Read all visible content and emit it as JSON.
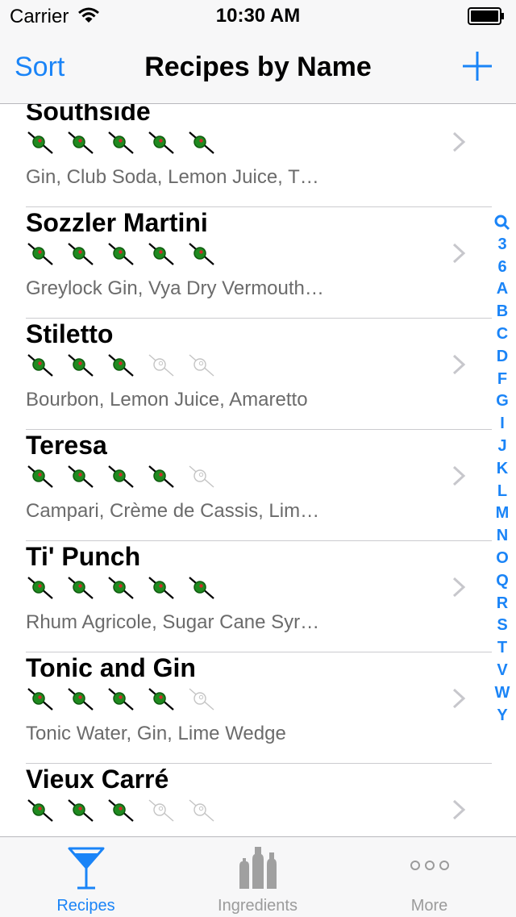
{
  "status": {
    "carrier": "Carrier",
    "time": "10:30 AM"
  },
  "nav": {
    "sort_label": "Sort",
    "title": "Recipes by Name",
    "add_icon": "plus-icon"
  },
  "colors": {
    "accent": "#1a84f7",
    "olive_active": "#1f8a1f",
    "olive_inactive": "#c4c4c4",
    "secondary_text": "#6b6b6b",
    "tab_inactive": "#9b9b9b"
  },
  "recipes": [
    {
      "name": "Southside",
      "rating": 5,
      "ingredients": "Gin, Club Soda, Lemon Juice, T…"
    },
    {
      "name": "Sozzler Martini",
      "rating": 5,
      "ingredients": "Greylock Gin, Vya Dry Vermouth…"
    },
    {
      "name": "Stiletto",
      "rating": 3,
      "ingredients": "Bourbon, Lemon Juice, Amaretto"
    },
    {
      "name": "Teresa",
      "rating": 4,
      "ingredients": "Campari, Crème de Cassis, Lim…"
    },
    {
      "name": "Ti' Punch",
      "rating": 5,
      "ingredients": "Rhum Agricole, Sugar Cane Syr…"
    },
    {
      "name": "Tonic and Gin",
      "rating": 4,
      "ingredients": "Tonic Water, Gin, Lime Wedge"
    },
    {
      "name": "Vieux Carré",
      "rating": 3,
      "ingredients": ""
    }
  ],
  "index": [
    "3",
    "6",
    "A",
    "B",
    "C",
    "D",
    "F",
    "G",
    "I",
    "J",
    "K",
    "L",
    "M",
    "N",
    "O",
    "Q",
    "R",
    "S",
    "T",
    "V",
    "W",
    "Y"
  ],
  "tabs": [
    {
      "label": "Recipes",
      "icon": "martini-glass-icon",
      "selected": true
    },
    {
      "label": "Ingredients",
      "icon": "bottles-icon",
      "selected": false
    },
    {
      "label": "More",
      "icon": "more-dots-icon",
      "selected": false
    }
  ]
}
